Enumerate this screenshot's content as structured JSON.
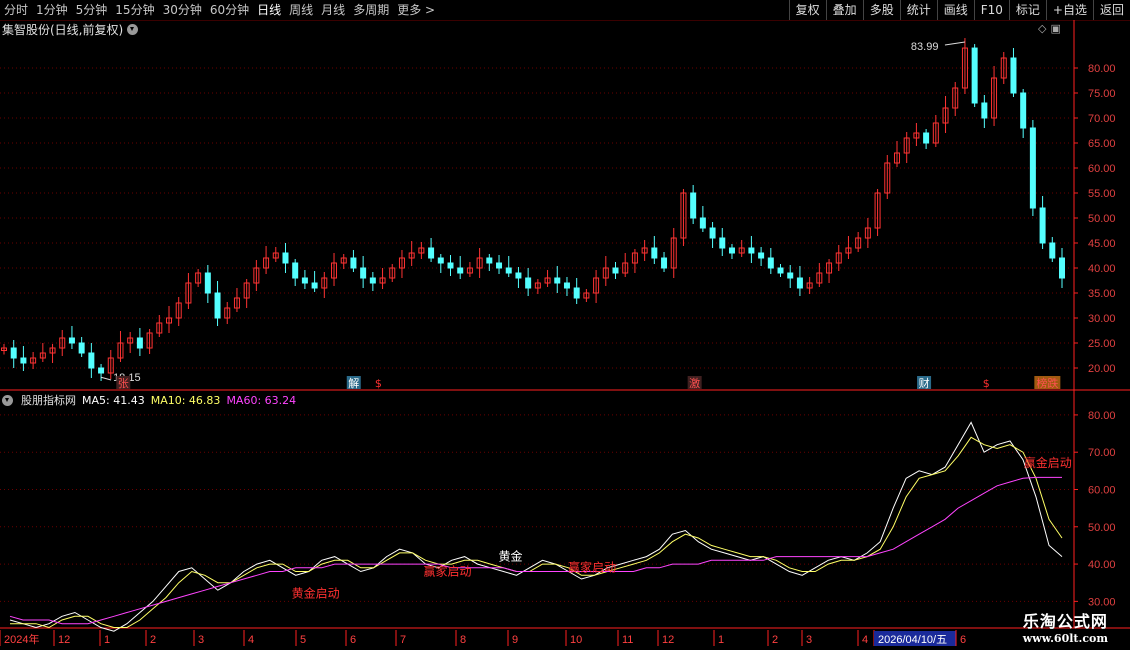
{
  "toolbar": {
    "left_tabs": [
      "分时",
      "1分钟",
      "5分钟",
      "15分钟",
      "30分钟",
      "60分钟",
      "日线",
      "周线",
      "月线",
      "多周期",
      "更多 >"
    ],
    "active_tab": "日线",
    "right_buttons": [
      "复权",
      "叠加",
      "多股",
      "统计",
      "画线",
      "F10",
      "标记",
      "+自选",
      "返回"
    ]
  },
  "chart_title": "集智股份(日线,前复权)",
  "indicator": {
    "name": "股朋指标网",
    "ma5": "MA5: 41.43",
    "ma10": "MA10: 46.83",
    "ma60": "MA60: 63.24"
  },
  "colors": {
    "up": "#ff3333",
    "down": "#54ffff",
    "ma5": "#ffffff",
    "ma10": "#ffff66",
    "ma60": "#ff44ff",
    "axis": "#ff2020",
    "grid": "#6a0000"
  },
  "chart_data": [
    {
      "type": "candlestick",
      "title": "集智股份(日线,前复权)",
      "y_ticks": [
        20.0,
        25.0,
        30.0,
        35.0,
        40.0,
        45.0,
        50.0,
        55.0,
        60.0,
        65.0,
        70.0,
        75.0,
        80.0
      ],
      "ylim": [
        16,
        86
      ],
      "annotations": {
        "high": "83.99",
        "low": "18.15"
      },
      "event_markers": [
        {
          "label": "张",
          "x": 0.115
        },
        {
          "label": "解",
          "x": 0.33
        },
        {
          "label": "$",
          "x": 0.353
        },
        {
          "label": "激",
          "x": 0.648
        },
        {
          "label": "财",
          "x": 0.862
        },
        {
          "label": "$",
          "x": 0.92
        },
        {
          "label": "榜跌",
          "x": 0.977
        }
      ],
      "close_path": [
        24,
        22,
        21,
        22,
        23,
        24,
        26,
        25,
        23,
        20,
        19,
        22,
        25,
        26,
        24,
        27,
        29,
        30,
        33,
        37,
        39,
        35,
        30,
        32,
        34,
        37,
        40,
        42,
        43,
        41,
        38,
        37,
        36,
        38,
        41,
        42,
        40,
        38,
        37,
        38,
        40,
        42,
        43,
        44,
        42,
        41,
        40,
        39,
        40,
        42,
        41,
        40,
        39,
        38,
        36,
        37,
        38,
        37,
        36,
        34,
        35,
        38,
        40,
        39,
        41,
        43,
        44,
        42,
        40,
        46,
        55,
        50,
        48,
        46,
        44,
        43,
        44,
        43,
        42,
        40,
        39,
        38,
        36,
        37,
        39,
        41,
        43,
        44,
        46,
        48,
        55,
        61,
        63,
        66,
        67,
        65,
        69,
        72,
        76,
        83.99,
        73,
        70,
        78,
        82,
        75,
        68,
        52,
        45,
        42,
        38
      ]
    },
    {
      "type": "line",
      "title": "股朋指标网",
      "y_ticks": [
        30.0,
        40.0,
        50.0,
        60.0,
        70.0,
        80.0
      ],
      "ylim": [
        25,
        84
      ],
      "series": [
        {
          "name": "MA5",
          "values": [
            25,
            24,
            23,
            24,
            26,
            27,
            25,
            23,
            22,
            24,
            27,
            30,
            34,
            38,
            39,
            36,
            33,
            35,
            38,
            40,
            41,
            39,
            37,
            38,
            41,
            42,
            40,
            38,
            39,
            42,
            44,
            43,
            40,
            39,
            41,
            42,
            40,
            39,
            38,
            37,
            39,
            41,
            40,
            38,
            36,
            37,
            39,
            40,
            41,
            42,
            44,
            48,
            49,
            46,
            44,
            43,
            42,
            41,
            42,
            40,
            38,
            37,
            39,
            41,
            42,
            41,
            43,
            46,
            55,
            63,
            65,
            64,
            66,
            72,
            78,
            70,
            72,
            73,
            68,
            58,
            45,
            42
          ]
        },
        {
          "name": "MA10",
          "values": [
            24,
            24,
            24,
            23,
            25,
            26,
            26,
            24,
            23,
            23,
            25,
            28,
            31,
            35,
            38,
            37,
            35,
            35,
            37,
            39,
            40,
            40,
            38,
            38,
            40,
            41,
            41,
            39,
            39,
            41,
            43,
            43,
            41,
            40,
            40,
            41,
            41,
            40,
            39,
            38,
            38,
            40,
            40,
            39,
            37,
            37,
            38,
            39,
            40,
            41,
            43,
            46,
            48,
            47,
            45,
            44,
            43,
            42,
            42,
            41,
            39,
            38,
            38,
            40,
            41,
            41,
            42,
            44,
            50,
            58,
            63,
            64,
            65,
            69,
            74,
            72,
            71,
            72,
            70,
            63,
            52,
            47
          ]
        },
        {
          "name": "MA60",
          "values": [
            26,
            25,
            25,
            25,
            24,
            24,
            24,
            25,
            26,
            27,
            28,
            29,
            30,
            31,
            32,
            33,
            34,
            35,
            36,
            37,
            38,
            38,
            39,
            39,
            39,
            40,
            40,
            40,
            40,
            40,
            40,
            40,
            40,
            40,
            39,
            39,
            39,
            39,
            39,
            38,
            38,
            38,
            38,
            38,
            38,
            38,
            38,
            38,
            38,
            39,
            39,
            40,
            40,
            40,
            41,
            41,
            41,
            41,
            41,
            42,
            42,
            42,
            42,
            42,
            42,
            42,
            42,
            43,
            44,
            46,
            48,
            50,
            52,
            55,
            57,
            59,
            61,
            62,
            63,
            63.24,
            63.24,
            63.24
          ]
        }
      ],
      "signal_labels": [
        {
          "text": "黄金启动",
          "x": 0.272,
          "y": 31
        },
        {
          "text": "赢家启动",
          "x": 0.395,
          "y": 37
        },
        {
          "text": "黄金",
          "x": 0.465,
          "y": 41
        },
        {
          "text": "赢家启动",
          "x": 0.53,
          "y": 38
        },
        {
          "text": "赢金启动",
          "x": 0.955,
          "y": 66
        }
      ]
    }
  ],
  "time_axis": {
    "labels": [
      "2024年",
      "12",
      "1",
      "2",
      "3",
      "4",
      "5",
      "6",
      "7",
      "8",
      "9",
      "10",
      "11",
      "12",
      "1",
      "2",
      "3",
      "4",
      "2026/04/10/五",
      "6"
    ]
  },
  "watermark": {
    "line1": "乐淘公式网",
    "line2": "www.60lt.com"
  }
}
